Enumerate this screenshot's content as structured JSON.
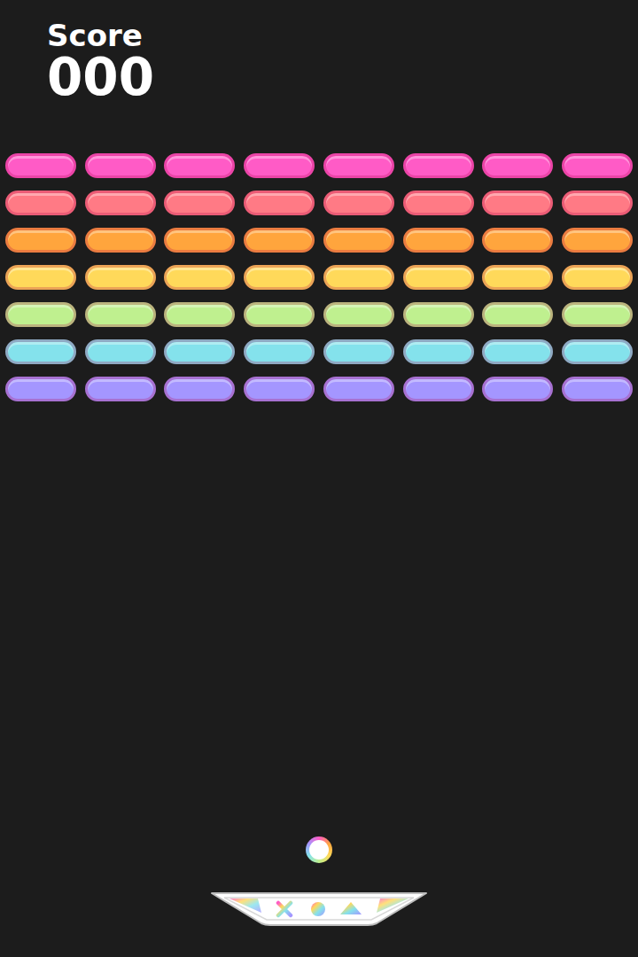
{
  "score": {
    "label": "Score",
    "value": "000"
  },
  "rows": [
    {
      "color": "#ff5bc6",
      "bricks": [
        {
          "intact": true
        },
        {
          "intact": true
        },
        {
          "intact": true
        },
        {
          "intact": true
        },
        {
          "intact": true
        },
        {
          "intact": true
        },
        {
          "intact": true
        },
        {
          "intact": true
        }
      ]
    },
    {
      "color": "#ff7a85",
      "bricks": [
        {
          "intact": true
        },
        {
          "intact": true
        },
        {
          "intact": true
        },
        {
          "intact": true
        },
        {
          "intact": true
        },
        {
          "intact": true
        },
        {
          "intact": true
        },
        {
          "intact": true
        }
      ]
    },
    {
      "color": "#ffa53d",
      "bricks": [
        {
          "intact": true
        },
        {
          "intact": true
        },
        {
          "intact": true
        },
        {
          "intact": true
        },
        {
          "intact": true
        },
        {
          "intact": true
        },
        {
          "intact": true
        },
        {
          "intact": true
        }
      ]
    },
    {
      "color": "#ffd95a",
      "bricks": [
        {
          "intact": true
        },
        {
          "intact": true
        },
        {
          "intact": true
        },
        {
          "intact": true
        },
        {
          "intact": true
        },
        {
          "intact": true
        },
        {
          "intact": true
        },
        {
          "intact": true
        }
      ]
    },
    {
      "color": "#bff08f",
      "bricks": [
        {
          "intact": true
        },
        {
          "intact": true
        },
        {
          "intact": true
        },
        {
          "intact": true
        },
        {
          "intact": true
        },
        {
          "intact": true
        },
        {
          "intact": true
        },
        {
          "intact": true
        }
      ]
    },
    {
      "color": "#84e2ec",
      "bricks": [
        {
          "intact": true
        },
        {
          "intact": true
        },
        {
          "intact": true
        },
        {
          "intact": true
        },
        {
          "intact": true
        },
        {
          "intact": true
        },
        {
          "intact": true
        },
        {
          "intact": true
        }
      ]
    },
    {
      "color": "#a496ff",
      "bricks": [
        {
          "intact": true
        },
        {
          "intact": true
        },
        {
          "intact": true
        },
        {
          "intact": true
        },
        {
          "intact": true
        },
        {
          "intact": true
        },
        {
          "intact": true
        },
        {
          "intact": true
        }
      ]
    }
  ]
}
